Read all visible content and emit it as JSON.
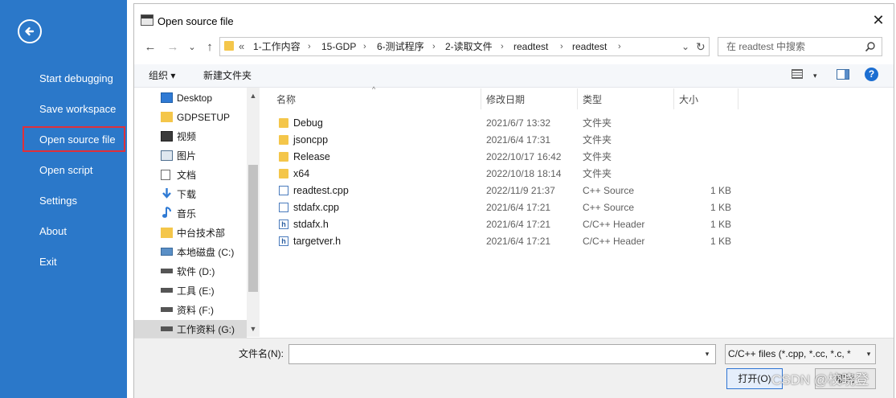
{
  "sidebar": {
    "items": [
      {
        "label": "Start debugging"
      },
      {
        "label": "Save workspace"
      },
      {
        "label": "Open source file"
      },
      {
        "label": "Open script"
      },
      {
        "label": "Settings"
      },
      {
        "label": "About"
      },
      {
        "label": "Exit"
      }
    ],
    "back_icon": "arrow-left-circle-icon"
  },
  "dialog": {
    "title": "Open source file",
    "close_glyph": "✕",
    "nav": {
      "back": "←",
      "forward": "→",
      "dropdown": "⌄",
      "up": "↑"
    },
    "breadcrumb": {
      "prefix": "«",
      "parts": [
        "1-工作内容",
        "15-GDP",
        "6-测试程序",
        "2-读取文件",
        "readtest",
        "readtest"
      ],
      "separator": "›",
      "dropdown": "⌄",
      "refresh": "↻"
    },
    "search": {
      "placeholder": "在 readtest 中搜索"
    },
    "toolbar": {
      "organize": "组织 ▾",
      "new_folder": "新建文件夹",
      "help": "?",
      "view_dropdown": "▾"
    },
    "nav_tree": [
      {
        "label": "Desktop",
        "icon": "desktop-icon"
      },
      {
        "label": "GDPSETUP",
        "icon": "folder-icon"
      },
      {
        "label": "视频",
        "icon": "video-icon"
      },
      {
        "label": "图片",
        "icon": "pictures-icon"
      },
      {
        "label": "文档",
        "icon": "document-icon"
      },
      {
        "label": "下载",
        "icon": "download-icon"
      },
      {
        "label": "音乐",
        "icon": "music-icon"
      },
      {
        "label": "中台技术部",
        "icon": "folder-icon"
      },
      {
        "label": "本地磁盘 (C:)",
        "icon": "drive-icon"
      },
      {
        "label": "软件 (D:)",
        "icon": "drive-icon"
      },
      {
        "label": "工具 (E:)",
        "icon": "drive-icon"
      },
      {
        "label": "资料 (F:)",
        "icon": "drive-icon"
      },
      {
        "label": "工作资料 (G:)",
        "icon": "drive-icon",
        "selected": true
      }
    ],
    "columns": {
      "name": "名称",
      "date": "修改日期",
      "type": "类型",
      "size": "大小"
    },
    "files": [
      {
        "name": "Debug",
        "date": "2021/6/7 13:32",
        "type": "文件夹",
        "size": "",
        "icon": "folder-icon"
      },
      {
        "name": "jsoncpp",
        "date": "2021/6/4 17:31",
        "type": "文件夹",
        "size": "",
        "icon": "folder-icon"
      },
      {
        "name": "Release",
        "date": "2022/10/17 16:42",
        "type": "文件夹",
        "size": "",
        "icon": "folder-icon"
      },
      {
        "name": "x64",
        "date": "2022/10/18 18:14",
        "type": "文件夹",
        "size": "",
        "icon": "folder-icon"
      },
      {
        "name": "readtest.cpp",
        "date": "2022/11/9 21:37",
        "type": "C++ Source",
        "size": "1 KB",
        "icon": "cpp-file-icon"
      },
      {
        "name": "stdafx.cpp",
        "date": "2021/6/4 17:21",
        "type": "C++ Source",
        "size": "1 KB",
        "icon": "cpp-file-icon"
      },
      {
        "name": "stdafx.h",
        "date": "2021/6/4 17:21",
        "type": "C/C++ Header",
        "size": "1 KB",
        "icon": "header-file-icon"
      },
      {
        "name": "targetver.h",
        "date": "2021/6/4 17:21",
        "type": "C/C++ Header",
        "size": "1 KB",
        "icon": "header-file-icon"
      }
    ],
    "footer": {
      "filename_label": "文件名(N):",
      "filename_value": "",
      "filter": "C/C++ files (*.cpp, *.cc, *.c, *",
      "open_button": "打开(O)",
      "cancel_button": "取消"
    }
  },
  "watermark": "CSDN @校晓登",
  "colors": {
    "sidebar_bg": "#2b78c9",
    "highlight_border": "#e0303a",
    "folder": "#f4c64a",
    "accent": "#1c6ed1"
  }
}
